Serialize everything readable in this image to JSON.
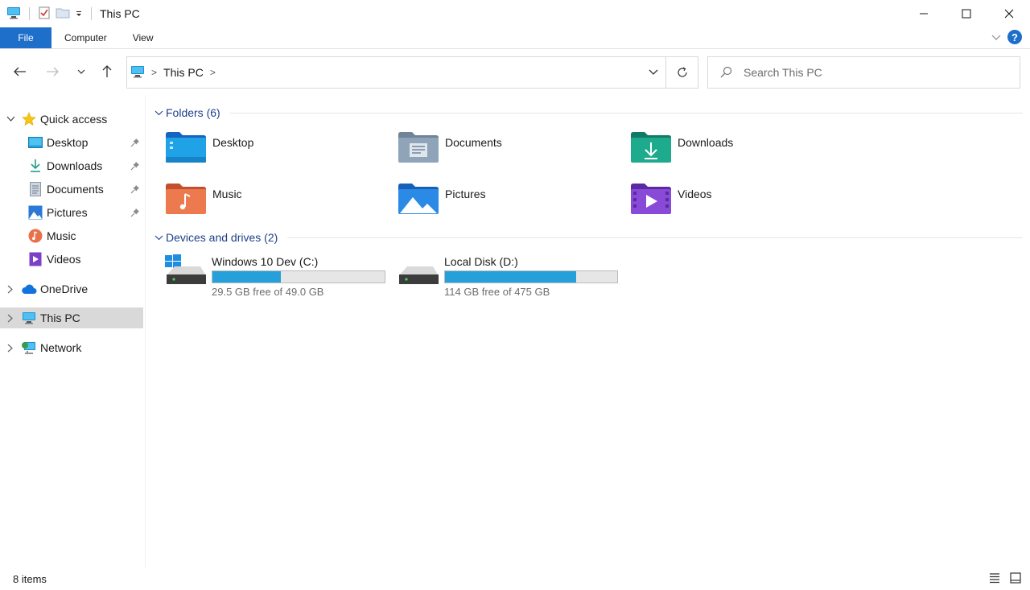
{
  "window": {
    "title": "This PC",
    "colors": {
      "accent": "#1e6fc9",
      "folder_header": "#1e3f8a",
      "drive_bar": "#26a0da",
      "selected": "#d9d9d9"
    }
  },
  "ribbon": {
    "tabs": [
      {
        "label": "File"
      },
      {
        "label": "Computer"
      },
      {
        "label": "View"
      }
    ],
    "help_label": "?"
  },
  "address": {
    "location": "This PC",
    "search_placeholder": "Search This PC"
  },
  "sidebar": {
    "quick_access": {
      "label": "Quick access",
      "items": [
        {
          "label": "Desktop",
          "icon": "desktop-icon",
          "pinned": true
        },
        {
          "label": "Downloads",
          "icon": "downloads-icon",
          "pinned": true
        },
        {
          "label": "Documents",
          "icon": "documents-icon",
          "pinned": true
        },
        {
          "label": "Pictures",
          "icon": "pictures-icon",
          "pinned": true
        },
        {
          "label": "Music",
          "icon": "music-icon",
          "pinned": false
        },
        {
          "label": "Videos",
          "icon": "videos-icon",
          "pinned": false
        }
      ]
    },
    "onedrive": {
      "label": "OneDrive"
    },
    "this_pc": {
      "label": "This PC",
      "selected": true
    },
    "network": {
      "label": "Network"
    }
  },
  "content": {
    "folders": {
      "header": "Folders (6)",
      "items": [
        {
          "name": "Desktop",
          "icon": "desktop-folder-icon"
        },
        {
          "name": "Documents",
          "icon": "documents-folder-icon"
        },
        {
          "name": "Downloads",
          "icon": "downloads-folder-icon"
        },
        {
          "name": "Music",
          "icon": "music-folder-icon"
        },
        {
          "name": "Pictures",
          "icon": "pictures-folder-icon"
        },
        {
          "name": "Videos",
          "icon": "videos-folder-icon"
        }
      ]
    },
    "drives": {
      "header": "Devices and drives (2)",
      "items": [
        {
          "name": "Windows 10 Dev (C:)",
          "free_text": "29.5 GB free of 49.0 GB",
          "used_fraction": 0.398
        },
        {
          "name": "Local Disk (D:)",
          "free_text": "114 GB free of 475 GB",
          "used_fraction": 0.76
        }
      ]
    }
  },
  "status": {
    "item_count": "8 items"
  }
}
